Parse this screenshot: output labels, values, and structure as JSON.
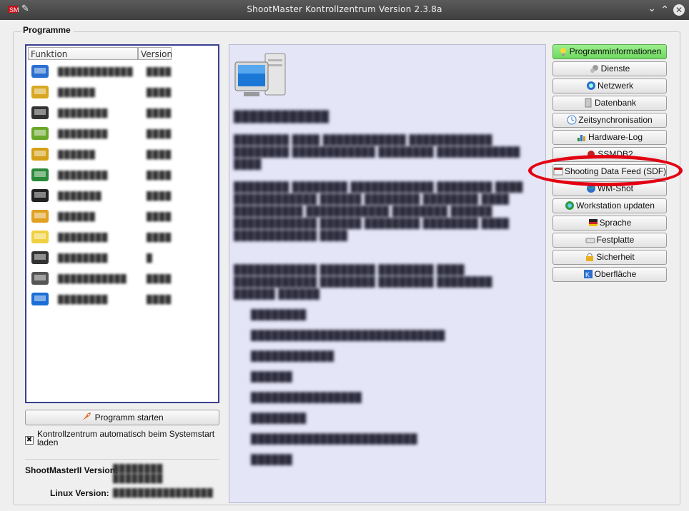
{
  "window": {
    "title": "ShootMaster Kontrollzentrum Version 2.3.8a",
    "controls": [
      "chevron-down",
      "chevron-up",
      "close"
    ]
  },
  "group": {
    "label": "Programme"
  },
  "list": {
    "columns": [
      "Funktion",
      "Version"
    ],
    "rows": [
      {
        "icon": "monitor-keyboard-icon",
        "name": "████████████",
        "version": "████"
      },
      {
        "icon": "document-writer-icon",
        "name": "██████",
        "version": "████"
      },
      {
        "icon": "people-icon",
        "name": "████████",
        "version": "████"
      },
      {
        "icon": "pen-chart-icon",
        "name": "████████",
        "version": "████"
      },
      {
        "icon": "trophy-icon",
        "name": "██████",
        "version": "████"
      },
      {
        "icon": "arrows-icon",
        "name": "████████",
        "version": "████"
      },
      {
        "icon": "target-icon",
        "name": "███████",
        "version": "████"
      },
      {
        "icon": "tools-icon",
        "name": "██████",
        "version": "████"
      },
      {
        "icon": "magic-wand-icon",
        "name": "████████",
        "version": "████"
      },
      {
        "icon": "terminal-icon",
        "name": "████████",
        "version": "█"
      },
      {
        "icon": "phone-icon",
        "name": "███████████",
        "version": "████"
      },
      {
        "icon": "desktop-icon",
        "name": "████████",
        "version": "████"
      }
    ]
  },
  "start_button": {
    "label": "Programm starten"
  },
  "autostart": {
    "label": "Kontrollzentrum automatisch beim Systemstart laden",
    "checked": true
  },
  "versions": {
    "shootmaster_label": "ShootMasterII Version:",
    "shootmaster_value": "████████ ████████",
    "linux_label": "Linux Version:",
    "linux_value": "████████████████"
  },
  "description": {
    "heading": "████████████",
    "paragraphs": [
      "████████ ████ ████████████ ████████████ ████████ ████████████ ████████ ████████████ ████",
      "████████ ████████ ████████████ ████████ ████ ████████████ ██████ ████████ ████████ ████ ██████████ ████████████ ████████ ██████ ████████████ ██████ ████████ ████████ ████ ████████████ ████",
      "████████████ ████████ ████████ ████ ████████████ ████████ ████████ ████████ ██████ ██████"
    ],
    "bullets": [
      "████████",
      "████████████████████████████",
      "████████████",
      "██████",
      "████████████████",
      "████████",
      "████████████████████████",
      "██████"
    ]
  },
  "right_buttons": [
    {
      "label": "Programminformationen",
      "icon": "lightbulb-icon",
      "active": true
    },
    {
      "label": "Dienste",
      "icon": "gears-icon",
      "active": false
    },
    {
      "label": "Netzwerk",
      "icon": "network-icon",
      "active": false
    },
    {
      "label": "Datenbank",
      "icon": "database-icon",
      "active": false
    },
    {
      "label": "Zeitsynchronisation",
      "icon": "clock-icon",
      "active": false
    },
    {
      "label": "Hardware-Log",
      "icon": "chart-icon",
      "active": false
    },
    {
      "label": "SSMDB2",
      "icon": "record-icon",
      "active": false
    },
    {
      "label": "Shooting Data Feed (SDF)",
      "icon": "sdf-icon",
      "active": false
    },
    {
      "label": "WM-Shot",
      "icon": "globe-icon",
      "active": false
    },
    {
      "label": "Workstation updaten",
      "icon": "update-globe-icon",
      "active": false
    },
    {
      "label": "Sprache",
      "icon": "flag-icon",
      "active": false
    },
    {
      "label": "Festplatte",
      "icon": "drive-icon",
      "active": false
    },
    {
      "label": "Sicherheit",
      "icon": "lock-icon",
      "active": false
    },
    {
      "label": "Oberfläche",
      "icon": "kde-icon",
      "active": false
    }
  ],
  "colors": {
    "titlebar": "#4a4a4a",
    "list_border": "#3a3f8f",
    "desc_bg": "#e4e5f7",
    "active_button": "#7de36d",
    "highlight": "#e20012"
  }
}
